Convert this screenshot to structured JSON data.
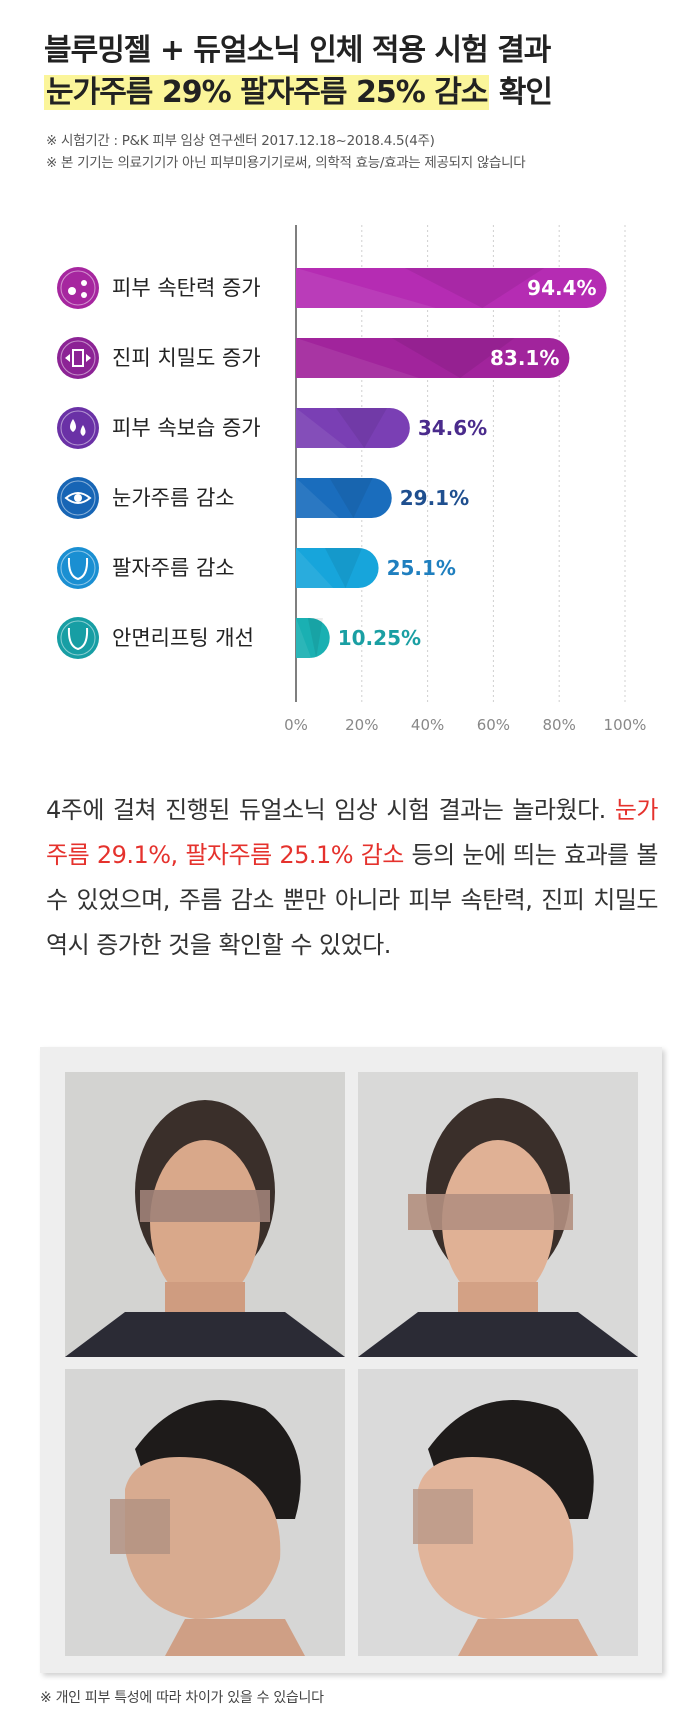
{
  "header": {
    "title_line1": "블루밍젤 + 듀얼소닉 인체 적용 시험 결과",
    "title_line2_highlight": "눈가주름 29% 팔자주름 25% 감소",
    "title_line2_rest": " 확인",
    "note1": "※ 시험기간 : P&K 피부 임상 연구센터 2017.12.18~2018.4.5(4주)",
    "note2": "※ 본 기기는 의료기기가 아닌 피부미용기기로써, 의학적 효능/효과는 제공되지 않습니다"
  },
  "chart_data": {
    "type": "bar",
    "orientation": "horizontal",
    "categories": [
      "피부 속탄력 증가",
      "진피 치밀도 증가",
      "피부 속보습 증가",
      "눈가주름 감소",
      "팔자주름 감소",
      "안면리프팅 개선"
    ],
    "values": [
      94.4,
      83.1,
      34.6,
      29.1,
      25.1,
      10.25
    ],
    "value_labels": [
      "94.4%",
      "83.1%",
      "34.6%",
      "29.1%",
      "25.1%",
      "10.25%"
    ],
    "icons": [
      "molecule-icon",
      "skin-density-icon",
      "water-drops-icon",
      "eye-icon",
      "face-nasolabial-icon",
      "face-lifting-icon"
    ],
    "colors": [
      "#b52cb3",
      "#a1249c",
      "#7a3fb4",
      "#1a6dbd",
      "#17a5db",
      "#1ab0b2"
    ],
    "icon_colors": [
      "#a6269f",
      "#8c2395",
      "#6a31a6",
      "#1765b5",
      "#1a8fd2",
      "#179ea4"
    ],
    "label_colors": [
      "#ffffff",
      "#ffffff",
      "#4a2b8c",
      "#1f4f8f",
      "#1f7fbf",
      "#1a9fa3"
    ],
    "xticks": [
      "0%",
      "20%",
      "40%",
      "60%",
      "80%",
      "100%"
    ],
    "xlim": [
      0,
      100
    ],
    "grid": true
  },
  "body": {
    "text_part1": "4주에 걸쳐 진행된 듀얼소닉 임상 시험 결과는 놀라웠다. ",
    "text_red": "눈가주름 29.1%, 팔자주름 25.1% 감소",
    "text_part2": " 등의 눈에 띄는 효과를 볼 수 있었으며, 주름 감소 뿐만 아니라 피부 속탄력, 진피 치밀도 역시 증가한 것을 확인할 수 있었다."
  },
  "gallery": {
    "photos": [
      "before-front-photo",
      "after-front-photo",
      "before-side-photo",
      "after-side-photo"
    ]
  },
  "footer": {
    "disclaimer": "※ 개인 피부 특성에 따라 차이가 있을 수 있습니다"
  }
}
